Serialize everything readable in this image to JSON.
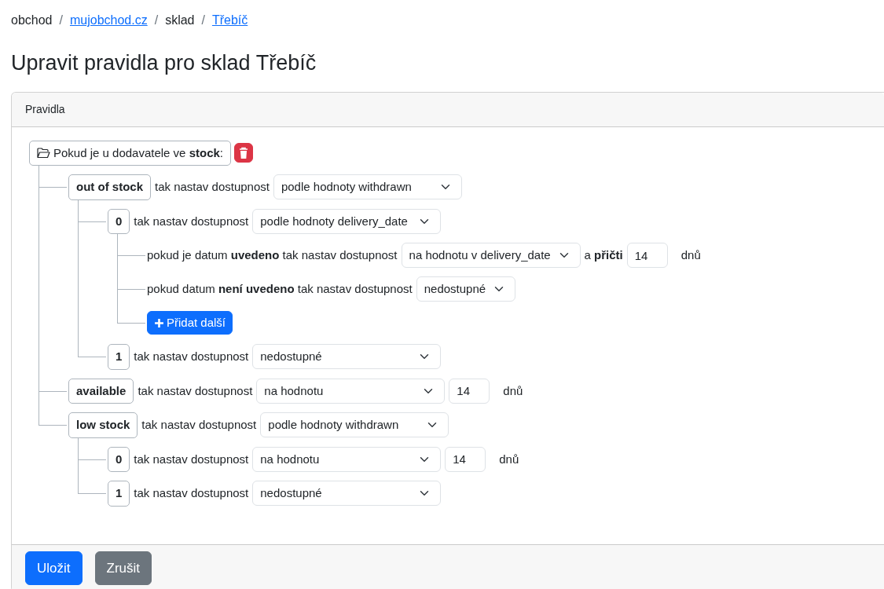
{
  "breadcrumb": {
    "separator": "/",
    "items": [
      {
        "label": "obchod",
        "link": false
      },
      {
        "label": "mujobchod.cz",
        "link": true
      },
      {
        "label": "sklad",
        "link": false
      },
      {
        "label": "Třebíč",
        "link": true
      }
    ]
  },
  "heading": "Upravit pravidla pro sklad Třebíč",
  "card": {
    "header": "Pravidla",
    "tree": {
      "label": "Pokud je u dodavatele ve **stock**:",
      "children": [
        {
          "kind": "value",
          "key": "out of stock",
          "text": "tak nastav dostupnost",
          "select": "podle hodnoty withdrawn",
          "children": [
            {
              "kind": "value",
              "key": "0",
              "text": "tak nastav dostupnost",
              "select": "podle hodnoty delivery_date",
              "children": [
                {
                  "kind": "condition",
                  "text": "pokud je datum **uvedeno** tak nastav dostupnost",
                  "select": "na hodnotu v delivery_date",
                  "days_prefix": "a **přičti**",
                  "days": "14",
                  "days_unit": "dnů"
                },
                {
                  "kind": "condition",
                  "text": "pokud datum **není uvedeno** tak nastav dostupnost",
                  "select": "nedostupné"
                },
                {
                  "kind": "add",
                  "label": "Přidat další"
                }
              ]
            },
            {
              "kind": "value",
              "key": "1",
              "text": "tak nastav dostupnost",
              "select": "nedostupné"
            }
          ]
        },
        {
          "kind": "value",
          "key": "available",
          "text": "tak nastav dostupnost",
          "select": "na hodnotu",
          "days": "14",
          "days_unit": "dnů"
        },
        {
          "kind": "value",
          "key": "low stock",
          "text": "tak nastav dostupnost",
          "select": "podle hodnoty withdrawn",
          "children": [
            {
              "kind": "value",
              "key": "0",
              "text": "tak nastav dostupnost",
              "select": "na hodnotu",
              "days": "14",
              "days_unit": "dnů"
            },
            {
              "kind": "value",
              "key": "1",
              "text": "tak nastav dostupnost",
              "select": "nedostupné"
            }
          ]
        }
      ]
    },
    "buttons": [
      {
        "label": "Uložit",
        "kind": "primary"
      },
      {
        "label": "Zrušit",
        "kind": "secondary"
      }
    ]
  }
}
